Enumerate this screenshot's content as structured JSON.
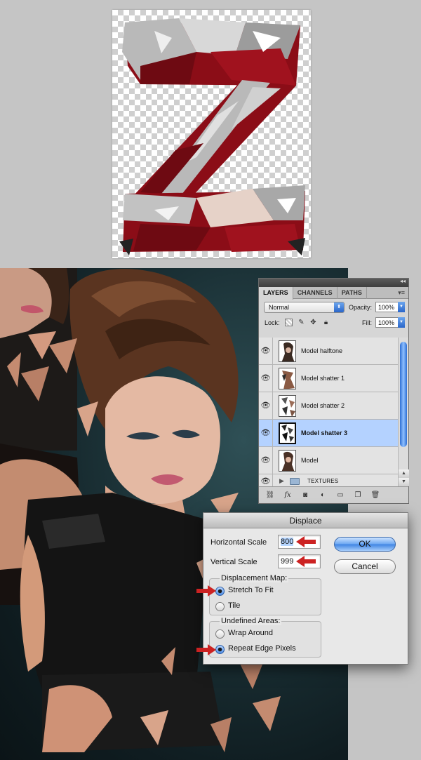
{
  "layers_panel": {
    "tabs": [
      "LAYERS",
      "CHANNELS",
      "PATHS"
    ],
    "blend_mode": "Normal",
    "opacity_label": "Opacity:",
    "opacity_value": "100%",
    "lock_label": "Lock:",
    "fill_label": "Fill:",
    "fill_value": "100%",
    "layers": [
      {
        "name": "Model halftone",
        "visible": true,
        "selected": false
      },
      {
        "name": "Model shatter 1",
        "visible": true,
        "selected": false
      },
      {
        "name": "Model shatter 2",
        "visible": true,
        "selected": false
      },
      {
        "name": "Model shatter 3",
        "visible": true,
        "selected": true
      },
      {
        "name": "Model",
        "visible": true,
        "selected": false
      }
    ],
    "group": {
      "name": "TEXTURES",
      "visible": true,
      "expanded": false
    },
    "footer_icons": [
      "link-icon",
      "fx-icon",
      "mask-icon",
      "adjustment-icon",
      "group-icon",
      "new-layer-icon",
      "trash-icon"
    ]
  },
  "displace_dialog": {
    "title": "Displace",
    "horizontal_scale_label": "Horizontal Scale",
    "horizontal_scale_value": "800",
    "vertical_scale_label": "Vertical Scale",
    "vertical_scale_value": "999",
    "ok_label": "OK",
    "cancel_label": "Cancel",
    "displacement_map_label": "Displacement Map:",
    "stretch_to_fit_label": "Stretch To Fit",
    "tile_label": "Tile",
    "displacement_map_selected": "Stretch To Fit",
    "undefined_areas_label": "Undefined Areas:",
    "wrap_around_label": "Wrap Around",
    "repeat_edge_pixels_label": "Repeat Edge Pixels",
    "undefined_areas_selected": "Repeat Edge Pixels"
  },
  "colors": {
    "selected_layer": "#b4d2ff",
    "highlight_arrow": "#cc2222",
    "z_red": "#8b0d17",
    "background": "#c5c5c5"
  }
}
